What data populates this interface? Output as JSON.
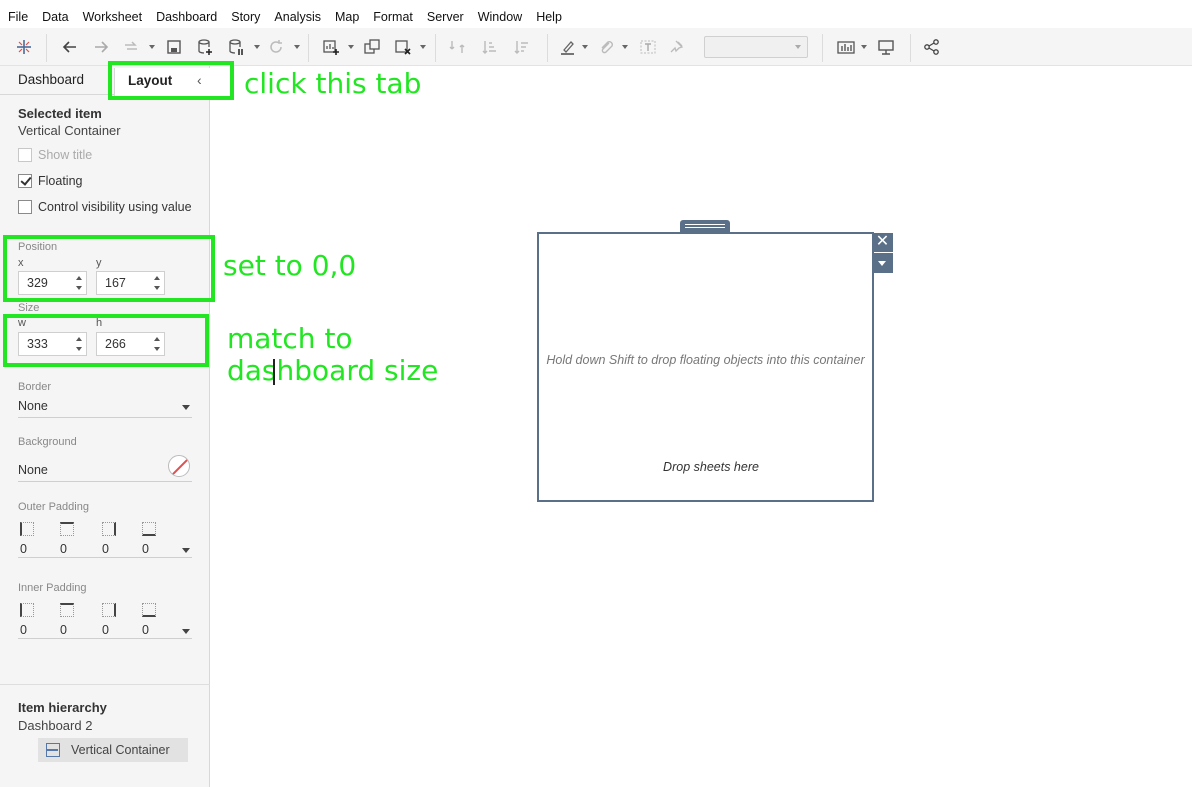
{
  "menu": [
    "File",
    "Data",
    "Worksheet",
    "Dashboard",
    "Story",
    "Analysis",
    "Map",
    "Format",
    "Server",
    "Window",
    "Help"
  ],
  "toolbar": {
    "icons": [
      "tableau-logo-icon",
      "undo-icon",
      "redo-icon",
      "replay-icon",
      "save-icon",
      "new-data-source-icon",
      "pause-updates-icon",
      "refresh-icon",
      "new-worksheet-icon",
      "duplicate-icon",
      "clear-icon",
      "swap-icon",
      "sort-ascending-icon",
      "sort-descending-icon",
      "highlight-icon",
      "attach-icon",
      "text-label-icon",
      "pin-icon",
      "show-me-icon",
      "presentation-icon",
      "share-icon"
    ]
  },
  "panel": {
    "tabs": {
      "dashboard": "Dashboard",
      "layout": "Layout"
    },
    "selected": {
      "heading": "Selected item",
      "name": "Vertical Container"
    },
    "options": {
      "show_title": "Show title",
      "floating": "Floating",
      "control_visibility": "Control visibility using value"
    },
    "position": {
      "label": "Position",
      "x_label": "x",
      "y_label": "y",
      "x": "329",
      "y": "167"
    },
    "size": {
      "label": "Size",
      "w_label": "w",
      "h_label": "h",
      "w": "333",
      "h": "266"
    },
    "border": {
      "label": "Border",
      "value": "None"
    },
    "background": {
      "label": "Background",
      "value": "None"
    },
    "outer_padding": {
      "label": "Outer Padding",
      "values": [
        "0",
        "0",
        "0",
        "0"
      ]
    },
    "inner_padding": {
      "label": "Inner Padding",
      "values": [
        "0",
        "0",
        "0",
        "0"
      ]
    },
    "hierarchy": {
      "heading": "Item hierarchy",
      "dashboard": "Dashboard 2",
      "item": "Vertical Container"
    }
  },
  "canvas": {
    "hint": "Hold down Shift to drop floating objects into this container",
    "drop_sheets": "Drop sheets here",
    "close_glyph": "✕"
  },
  "annotations": {
    "tab": "click this tab",
    "position": "set to 0,0",
    "size": "match to dashboard size",
    "color": "#22e622"
  }
}
